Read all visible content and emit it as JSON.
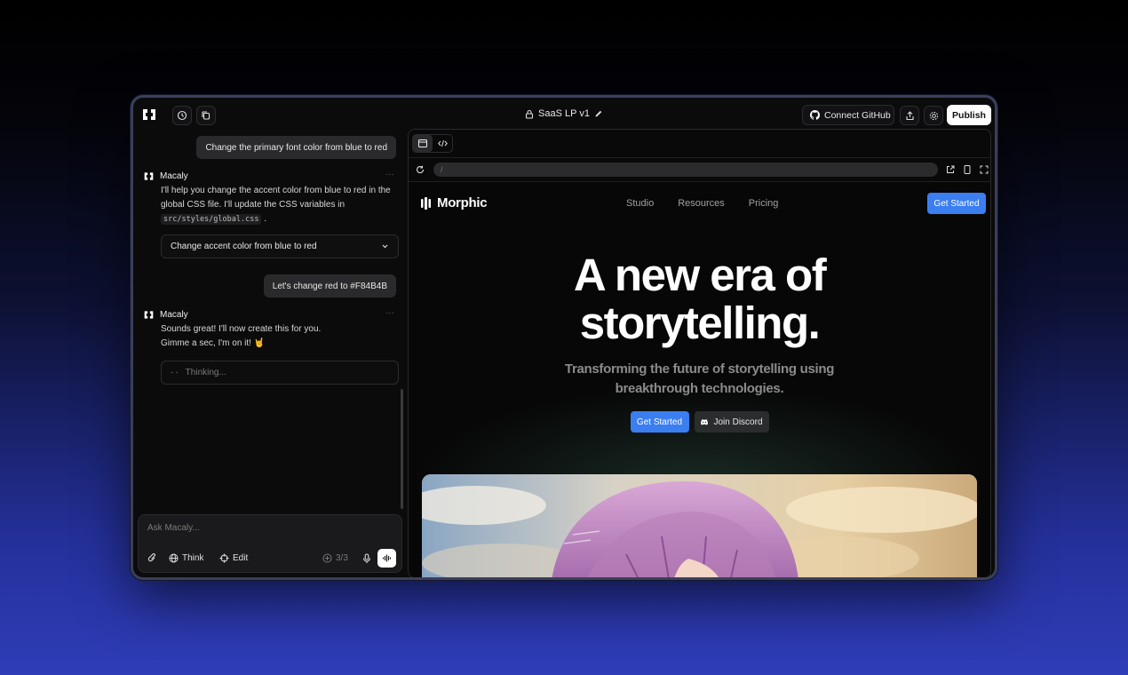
{
  "app": {
    "project_title": "SaaS LP v1",
    "connect_label": "Connect GitHub",
    "publish_label": "Publish"
  },
  "chat": {
    "messages": [
      {
        "role": "user",
        "text": "Change the primary font color from blue to red"
      },
      {
        "role": "assistant",
        "name": "Macaly",
        "more": "···",
        "text_before": "I'll help you change the accent color from blue to red in the global CSS file. I'll update the CSS variables in",
        "code": "src/styles/global.css",
        "text_after": ".",
        "task_label": "Change accent color from blue to red"
      },
      {
        "role": "user",
        "text": "Let's change red to #F84B4B"
      },
      {
        "role": "assistant",
        "name": "Macaly",
        "more": "···",
        "line1": "Sounds great! I'll now create this for you.",
        "line2": "Gimme a sec, I'm on it! 🤘",
        "status": "Thinking..."
      }
    ],
    "composer": {
      "placeholder": "Ask Macaly...",
      "think_label": "Think",
      "edit_label": "Edit",
      "credits": "3/3"
    }
  },
  "preview": {
    "url": "/",
    "site": {
      "brand": "Morphic",
      "nav": [
        "Studio",
        "Resources",
        "Pricing"
      ],
      "cta": "Get Started",
      "hero_line1": "A new era of",
      "hero_line2": "storytelling.",
      "sub_line1": "Transforming the future of storytelling using",
      "sub_line2": "breakthrough technologies.",
      "primary_btn": "Get Started",
      "secondary_btn": "Join Discord"
    }
  },
  "colors": {
    "accent_blue": "#3b7ef0",
    "panel_bg": "#0b0b0c",
    "bubble_bg": "#2a2a2c"
  },
  "icons": [
    "macaly-logo-icon",
    "history-icon",
    "copy-icon",
    "lock-icon",
    "pencil-icon",
    "github-icon",
    "share-icon",
    "gear-icon",
    "paperclip-icon",
    "globe-icon",
    "edit-target-icon",
    "plus-circle-icon",
    "mic-icon",
    "waveform-icon",
    "browser-icon",
    "code-icon",
    "refresh-icon",
    "external-link-icon",
    "mobile-icon",
    "fullscreen-icon",
    "discord-icon",
    "chevron-down-icon"
  ]
}
